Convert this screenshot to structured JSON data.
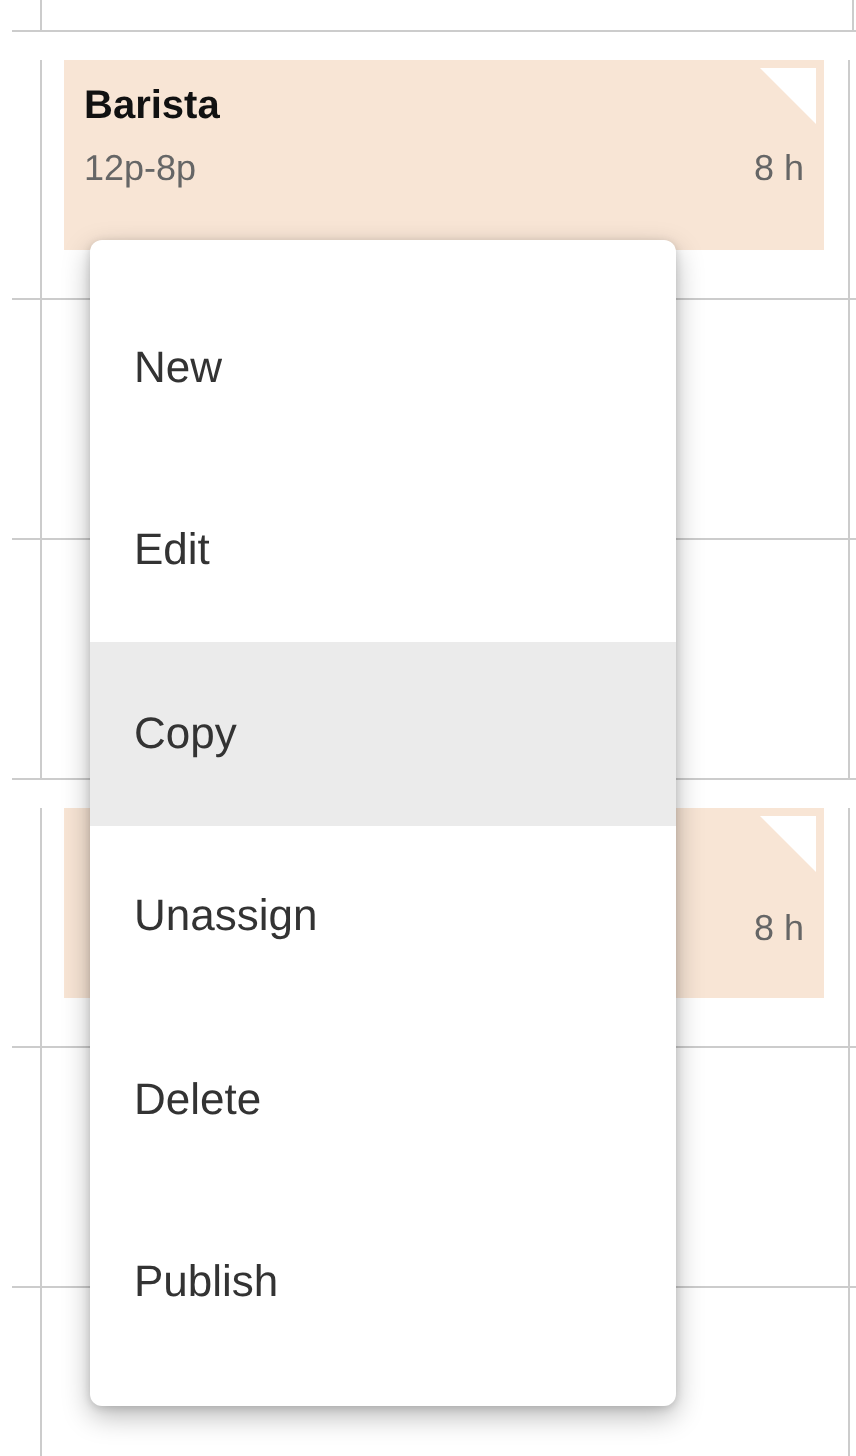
{
  "schedule": {
    "rows": [
      {
        "shift": {
          "title": "Barista",
          "time": "12p-8p",
          "hours": "8 h"
        }
      },
      {},
      {},
      {
        "shift": {
          "hours": "8 h"
        }
      },
      {},
      {}
    ]
  },
  "context_menu": {
    "items": [
      {
        "label": "New",
        "selected": false
      },
      {
        "label": "Edit",
        "selected": false
      },
      {
        "label": "Copy",
        "selected": true
      },
      {
        "label": "Unassign",
        "selected": false
      },
      {
        "label": "Delete",
        "selected": false
      },
      {
        "label": "Publish",
        "selected": false
      }
    ]
  }
}
